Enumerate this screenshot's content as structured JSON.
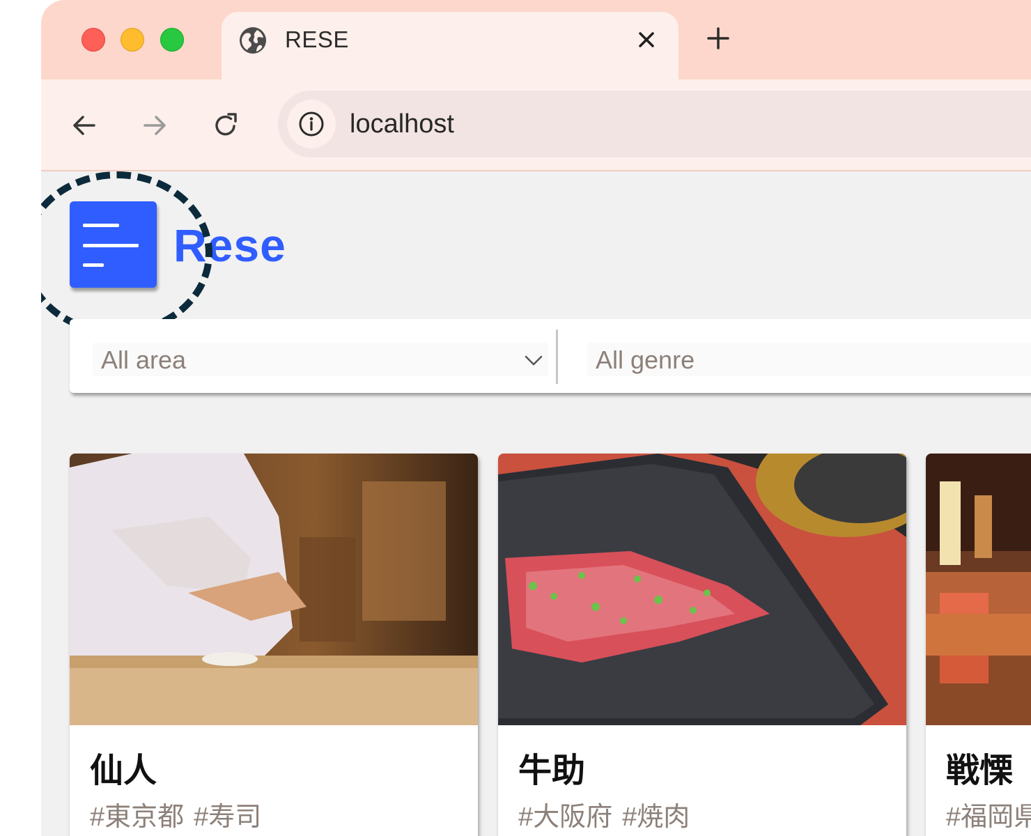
{
  "browser": {
    "tab_title": "RESE",
    "url": "localhost",
    "icons": [
      "globe-icon",
      "close-icon",
      "plus-icon",
      "back-arrow-icon",
      "forward-arrow-icon",
      "reload-icon",
      "info-icon"
    ]
  },
  "app": {
    "logo_text": "Rese",
    "brand_color": "#305dff",
    "menu_icon": "menu-icon"
  },
  "search": {
    "area_selected": "All area",
    "genre_selected": "All genre"
  },
  "shops": [
    {
      "name": "仙人",
      "area_tag": "#東京都",
      "genre_tag": "#寿司"
    },
    {
      "name": "牛助",
      "area_tag": "#大阪府",
      "genre_tag": "#焼肉"
    },
    {
      "name": "戦慄",
      "area_tag": "#福岡県",
      "genre_tag": ""
    }
  ]
}
